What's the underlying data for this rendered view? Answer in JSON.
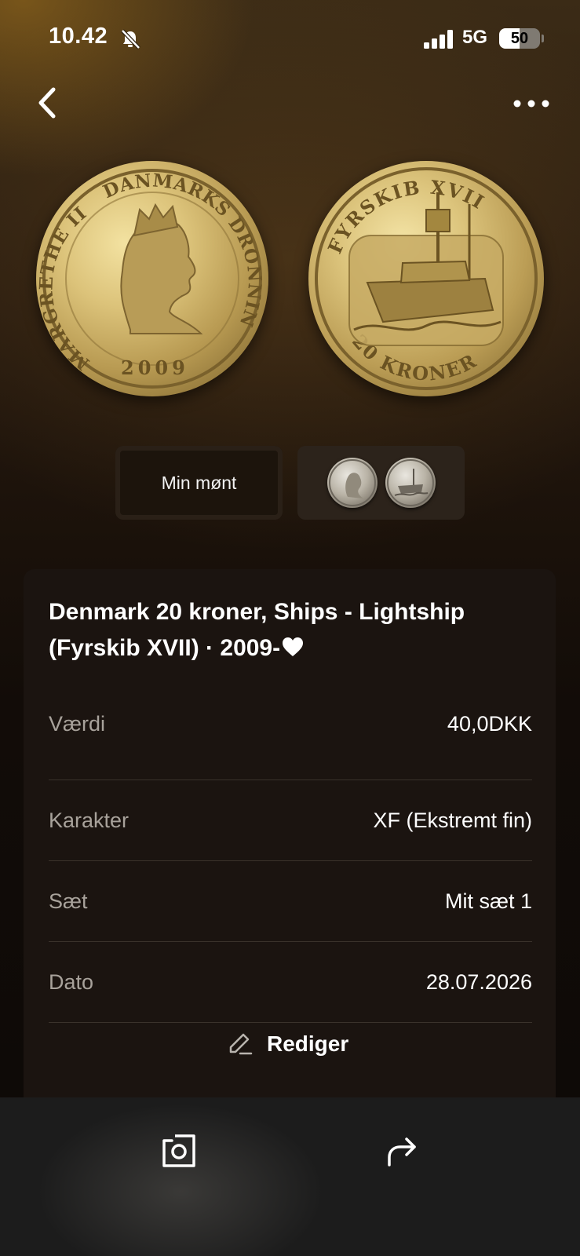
{
  "status_bar": {
    "time": "10.42",
    "network": "5G",
    "battery": "50",
    "icons": [
      "bell-slash-icon",
      "signal-bars-icon"
    ]
  },
  "nav": {
    "back_icon": "chevron-left-icon",
    "more_icon": "ellipsis-icon"
  },
  "coin_images": {
    "obverse": {
      "legend_left": "MARGRETHE II",
      "legend_right": "DANMARKS DRONNING",
      "year": "2009"
    },
    "reverse": {
      "legend_top": "FYRSKIB XVII",
      "legend_bottom": "20 KRONER"
    }
  },
  "selector": {
    "label_tile": "Min mønt",
    "thumbnails_tile": "coin-thumbnails"
  },
  "details": {
    "title": "Denmark 20 kroner, Ships - Lightship (Fyrskib XVII) · 2009-",
    "favorite_icon": "heart-icon",
    "rows": [
      {
        "label": "Værdi",
        "value": "40,0DKK"
      },
      {
        "label": "Karakter",
        "value": "XF (Ekstremt fin)"
      },
      {
        "label": "Sæt",
        "value": "Mit sæt 1"
      },
      {
        "label": "Dato",
        "value": "28.07.2026"
      }
    ],
    "edit_label": "Rediger",
    "edit_icon": "pencil-icon"
  },
  "bottom_bar": {
    "photo_icon": "camera-icon",
    "share_icon": "share-arrow-icon"
  },
  "colors": {
    "card_bg": "#1b1410",
    "label_text": "#a8a29b",
    "coin_gold": "#dcc37a"
  }
}
